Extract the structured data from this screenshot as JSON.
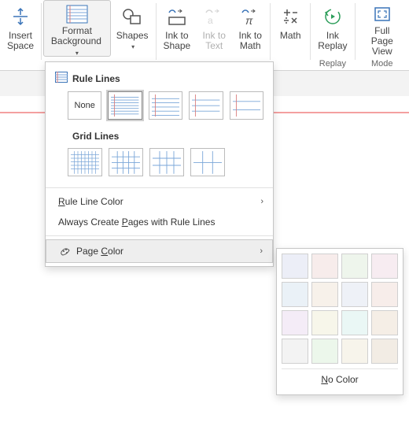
{
  "ribbon": {
    "insert_space": "Insert\nSpace",
    "format_background": "Format\nBackground",
    "shapes": "Shapes",
    "ink_to_shape": "Ink to\nShape",
    "ink_to_text": "Ink to\nText",
    "ink_to_math": "Ink to\nMath",
    "math": "Math",
    "ink_replay": "Ink\nReplay",
    "full_page_view": "Full Page\nView",
    "group_replay": "Replay",
    "group_mode": "Mode"
  },
  "dropdown": {
    "rule_lines_title": "Rule Lines",
    "grid_lines_title": "Grid Lines",
    "none_label": "None",
    "rule_line_color": "Rule Line Color",
    "always_create": "Always Create Pages with Rule Lines",
    "page_color": "Page Color"
  },
  "flyout": {
    "no_color": "No Color",
    "colors": [
      "#eceef7",
      "#f7eceb",
      "#eef5ec",
      "#f7ecf1",
      "#eaf1f7",
      "#f7f1ea",
      "#eef1f7",
      "#f7edea",
      "#f4ecf7",
      "#f7f6ea",
      "#eaf7f5",
      "#f5eee6",
      "#f3f3f3",
      "#ecf7eb",
      "#f7f4eb",
      "#f2ece4"
    ]
  }
}
